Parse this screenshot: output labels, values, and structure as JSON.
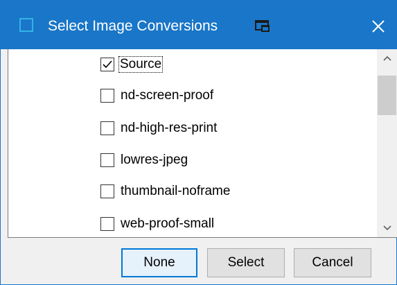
{
  "window": {
    "title": "Select Image Conversions",
    "accent_color": "#1976c8",
    "icons": {
      "app": "app-icon",
      "pin": "pin-window-icon",
      "close": "close-icon"
    }
  },
  "list": {
    "items": [
      {
        "label": "Source",
        "checked": true,
        "focused": true
      },
      {
        "label": "nd-screen-proof",
        "checked": false,
        "focused": false
      },
      {
        "label": "nd-high-res-print",
        "checked": false,
        "focused": false
      },
      {
        "label": "lowres-jpeg",
        "checked": false,
        "focused": false
      },
      {
        "label": "thumbnail-noframe",
        "checked": false,
        "focused": false
      },
      {
        "label": "web-proof-small",
        "checked": false,
        "focused": false
      }
    ]
  },
  "buttons": {
    "none": "None",
    "select": "Select",
    "cancel": "Cancel"
  }
}
